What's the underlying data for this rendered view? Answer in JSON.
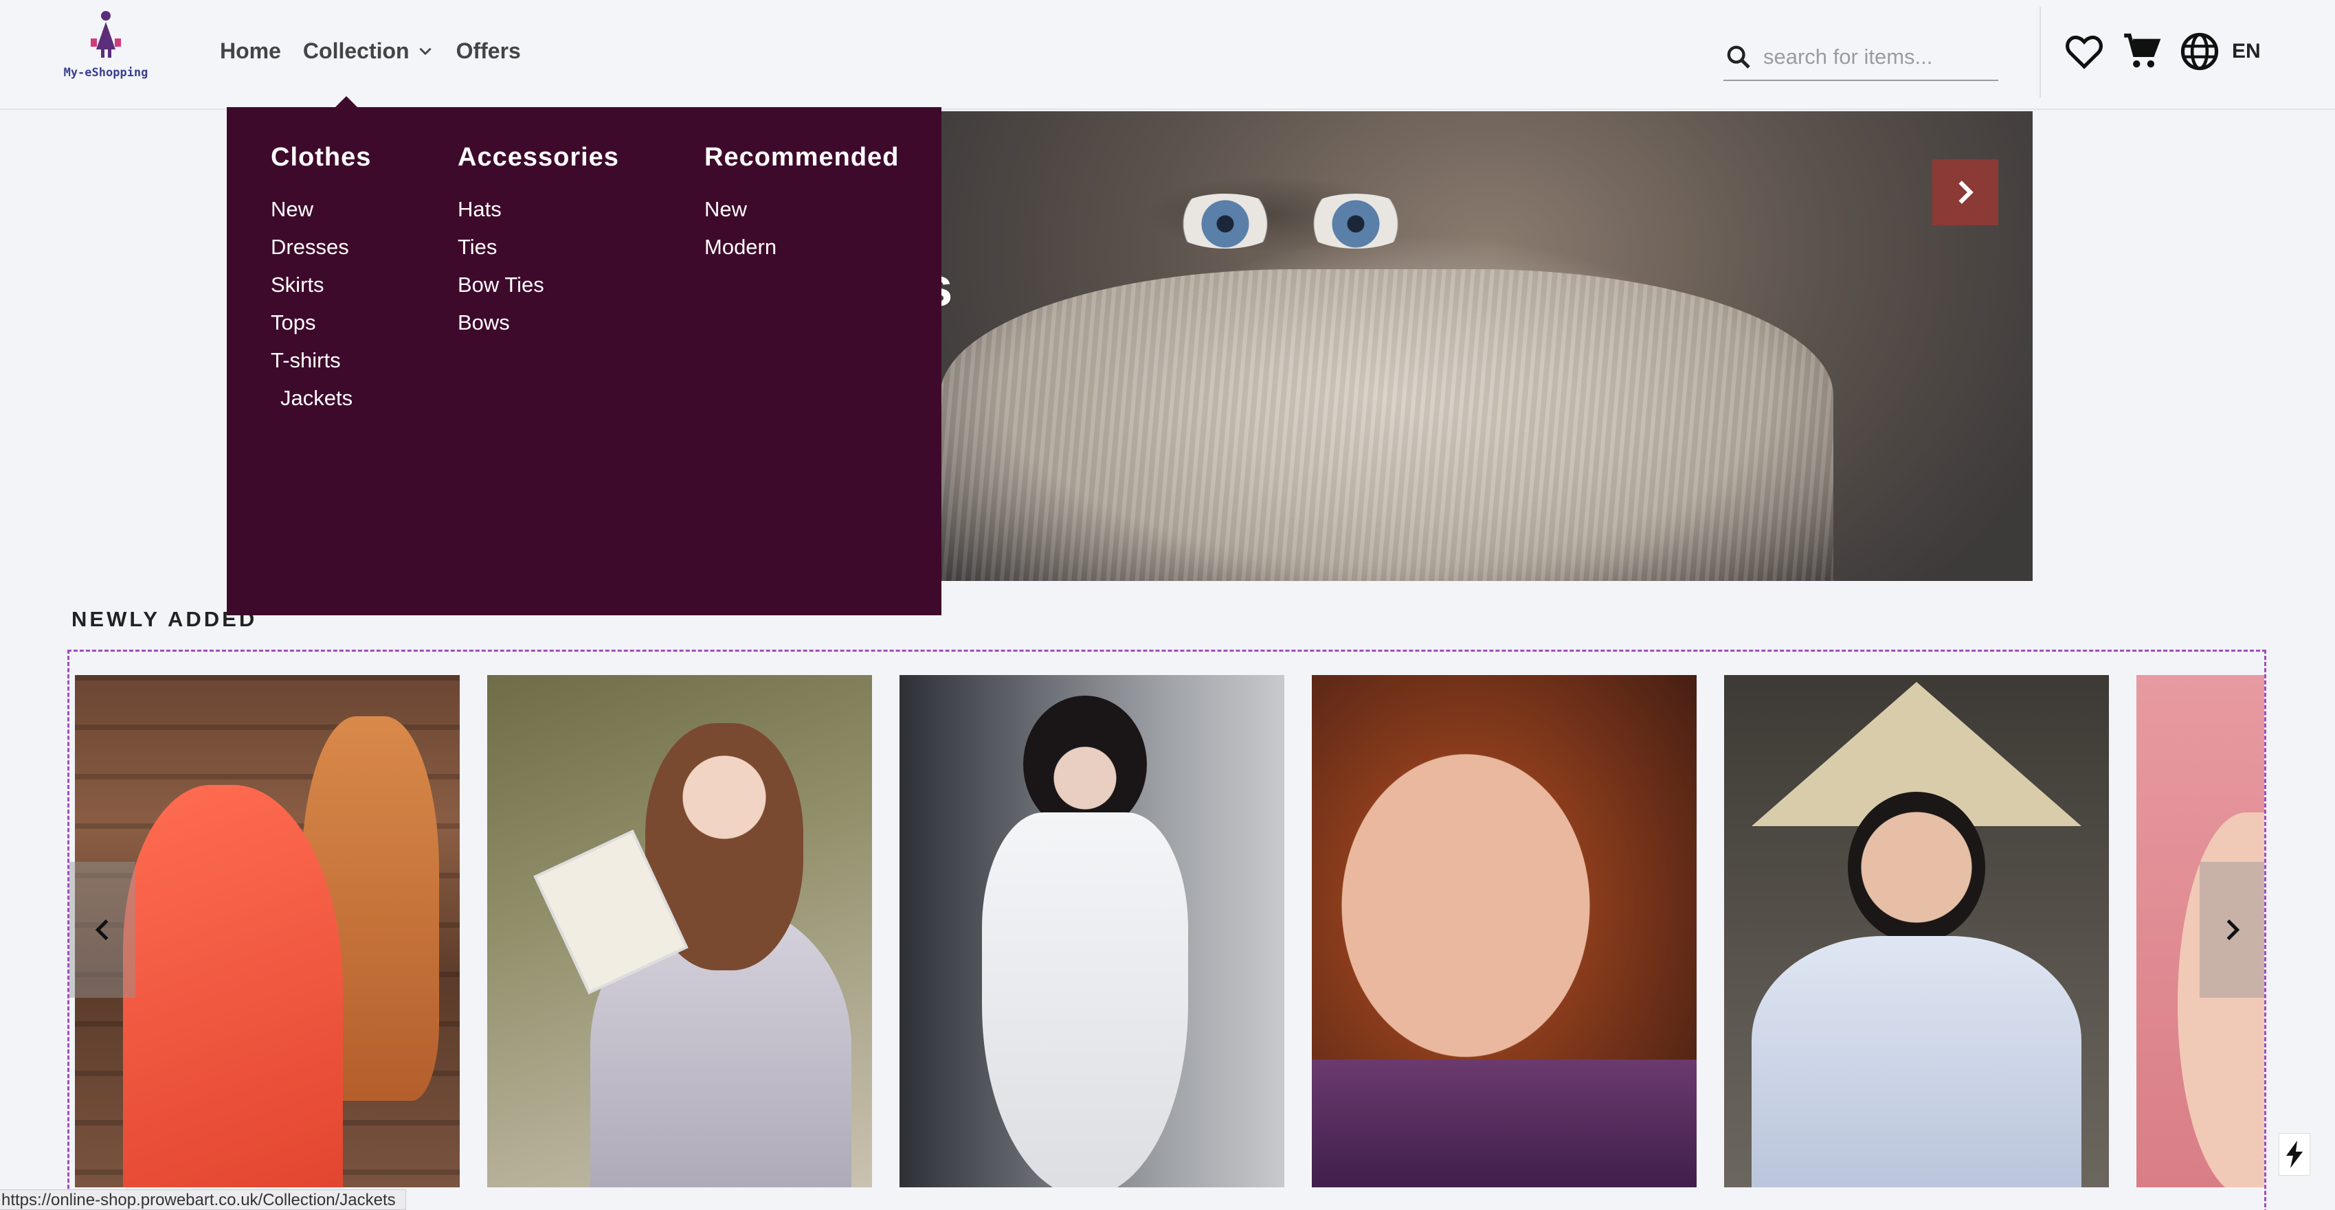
{
  "brand": {
    "name": "My-eShopping"
  },
  "nav": {
    "home": "Home",
    "collection": "Collection",
    "offers": "Offers"
  },
  "search": {
    "placeholder": "search for items..."
  },
  "header_icons": {
    "wishlist": "heart-icon",
    "cart": "cart-icon",
    "language_icon": "globe-icon",
    "language": "EN"
  },
  "hero": {
    "title_fragment": "s",
    "next": "chevron-right-icon"
  },
  "mega_menu": {
    "columns": [
      {
        "title": "Clothes",
        "items": [
          "New",
          "Dresses",
          "Skirts",
          "Tops",
          "T-shirts",
          " Jackets"
        ]
      },
      {
        "title": "Accessories",
        "items": [
          "Hats",
          "Ties",
          "Bow Ties",
          "Bows"
        ]
      },
      {
        "title": "Recommended",
        "items": [
          "New",
          "Modern"
        ]
      }
    ]
  },
  "newly_added": {
    "title": "NEWLY ADDED",
    "prev": "chevron-left-icon",
    "next": "chevron-right-icon"
  },
  "status_url": "https://online-shop.prowebart.co.uk/Collection/Jackets",
  "colors": {
    "menu_bg": "#3e0a2b",
    "accent_button": "#8b3a36",
    "carousel_border": "#a14cc1",
    "page_bg": "#f3f4f8"
  }
}
